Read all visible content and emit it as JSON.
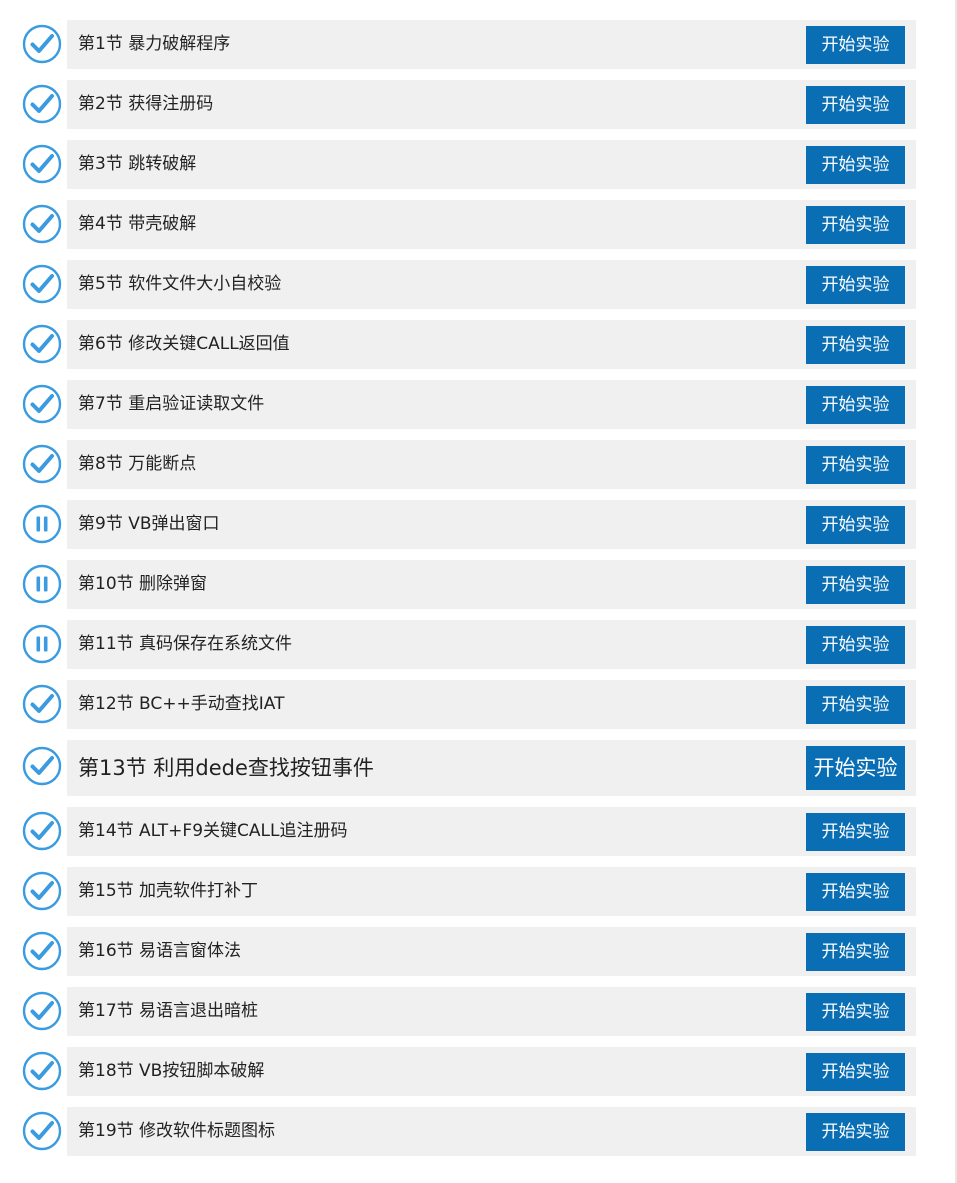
{
  "lessons": [
    {
      "title": "第1节 暴力破解程序",
      "button": "开始实验",
      "status": "done",
      "status_icon": "check-circle-icon"
    },
    {
      "title": "第2节 获得注册码",
      "button": "开始实验",
      "status": "done",
      "status_icon": "check-circle-icon"
    },
    {
      "title": "第3节 跳转破解",
      "button": "开始实验",
      "status": "done",
      "status_icon": "check-circle-icon"
    },
    {
      "title": "第4节 带壳破解",
      "button": "开始实验",
      "status": "done",
      "status_icon": "check-circle-icon"
    },
    {
      "title": "第5节 软件文件大小自校验",
      "button": "开始实验",
      "status": "done",
      "status_icon": "check-circle-icon"
    },
    {
      "title": "第6节 修改关键CALL返回值",
      "button": "开始实验",
      "status": "done",
      "status_icon": "check-circle-icon"
    },
    {
      "title": "第7节 重启验证读取文件",
      "button": "开始实验",
      "status": "done",
      "status_icon": "check-circle-icon"
    },
    {
      "title": "第8节 万能断点",
      "button": "开始实验",
      "status": "done",
      "status_icon": "check-circle-icon"
    },
    {
      "title": "第9节 VB弹出窗口",
      "button": "开始实验",
      "status": "paused",
      "status_icon": "pause-circle-icon"
    },
    {
      "title": "第10节 删除弹窗",
      "button": "开始实验",
      "status": "paused",
      "status_icon": "pause-circle-icon"
    },
    {
      "title": "第11节 真码保存在系统文件",
      "button": "开始实验",
      "status": "paused",
      "status_icon": "pause-circle-icon"
    },
    {
      "title": "第12节 BC++手动查找IAT",
      "button": "开始实验",
      "status": "done",
      "status_icon": "check-circle-icon"
    },
    {
      "title": "第13节 利用dede查找按钮事件",
      "button": "开始实验",
      "status": "done",
      "status_icon": "check-circle-icon"
    },
    {
      "title": "第14节 ALT+F9关键CALL追注册码",
      "button": "开始实验",
      "status": "done",
      "status_icon": "check-circle-icon"
    },
    {
      "title": "第15节 加壳软件打补丁",
      "button": "开始实验",
      "status": "done",
      "status_icon": "check-circle-icon"
    },
    {
      "title": "第16节 易语言窗体法",
      "button": "开始实验",
      "status": "done",
      "status_icon": "check-circle-icon"
    },
    {
      "title": "第17节 易语言退出暗桩",
      "button": "开始实验",
      "status": "done",
      "status_icon": "check-circle-icon"
    },
    {
      "title": "第18节 VB按钮脚本破解",
      "button": "开始实验",
      "status": "done",
      "status_icon": "check-circle-icon"
    },
    {
      "title": "第19节 修改软件标题图标",
      "button": "开始实验",
      "status": "done",
      "status_icon": "check-circle-icon"
    }
  ],
  "colors": {
    "accent": "#0a6eb4",
    "status_icon": "#3a9be0",
    "row_background": "#f0f0f0",
    "text": "#222222"
  }
}
